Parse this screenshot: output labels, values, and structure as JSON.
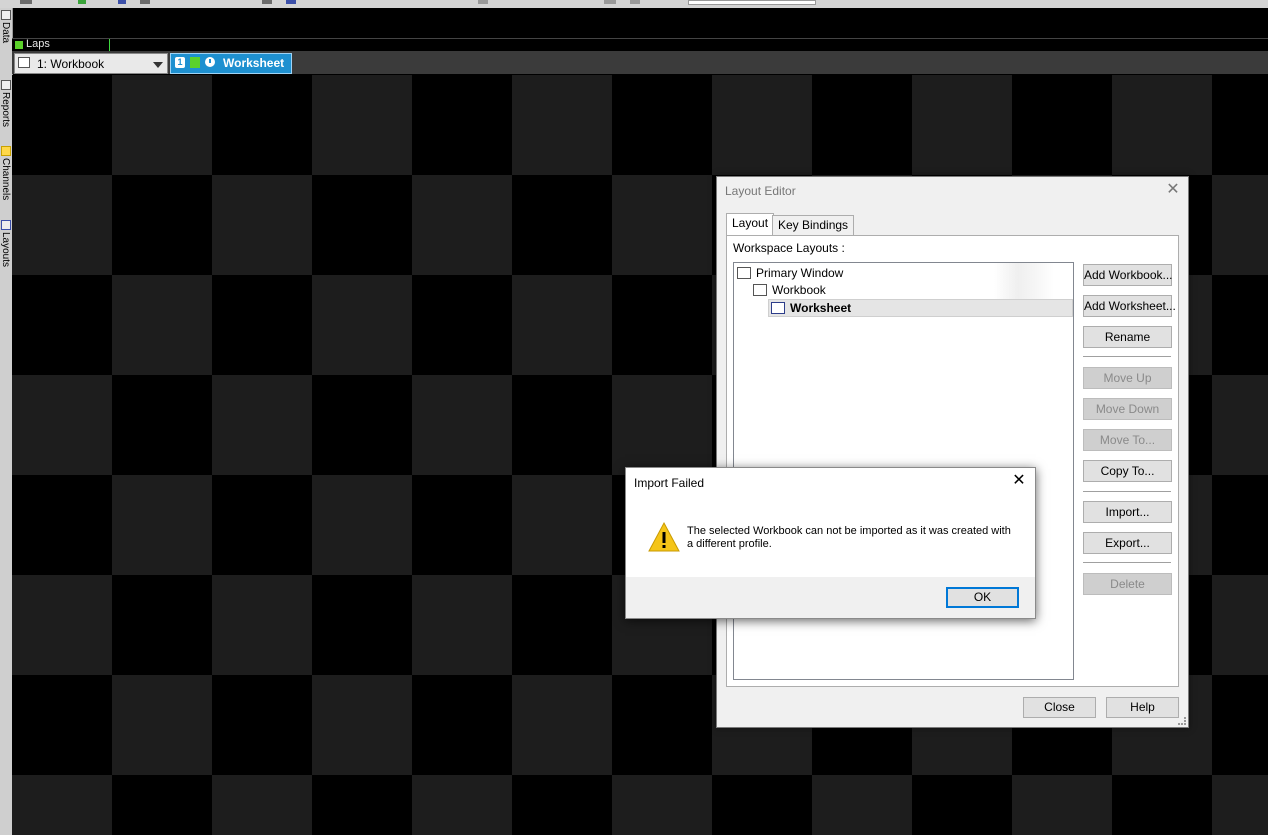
{
  "side_tabs": [
    "Data",
    "Reports",
    "Channels",
    "Layouts"
  ],
  "laps_bar": {
    "label": "Laps"
  },
  "workbook_selector": {
    "selected": "1: Workbook"
  },
  "worksheet_tab": {
    "number": "1",
    "label": "Worksheet"
  },
  "layout_editor": {
    "title": "Layout Editor",
    "tabs": [
      "Layout",
      "Key Bindings"
    ],
    "active_tab": "Layout",
    "workspace_layouts_label": "Workspace Layouts :",
    "tree": [
      {
        "label": "Primary Window",
        "level": 0
      },
      {
        "label": "Workbook",
        "level": 1
      },
      {
        "label": "Worksheet",
        "level": 2,
        "selected": true
      }
    ],
    "buttons": {
      "add_workbook": "Add Workbook...",
      "add_worksheet": "Add Worksheet...",
      "rename": "Rename",
      "move_up": "Move Up",
      "move_down": "Move Down",
      "move_to": "Move To...",
      "copy_to": "Copy To...",
      "import": "Import...",
      "export": "Export...",
      "delete": "Delete"
    },
    "disabled_buttons": [
      "Move Up",
      "Move Down",
      "Move To...",
      "Delete"
    ],
    "footer": {
      "close": "Close",
      "help": "Help"
    }
  },
  "import_failed": {
    "title": "Import Failed",
    "message": "The selected Workbook can not be imported as it was created with a different profile.",
    "ok": "OK"
  },
  "colors": {
    "accent_tab": "#1e90d0",
    "laps_green": "#5bd12a",
    "checker_dark": "#000000",
    "checker_light": "#1d1d1d",
    "warning_yellow": "#f5c518"
  }
}
